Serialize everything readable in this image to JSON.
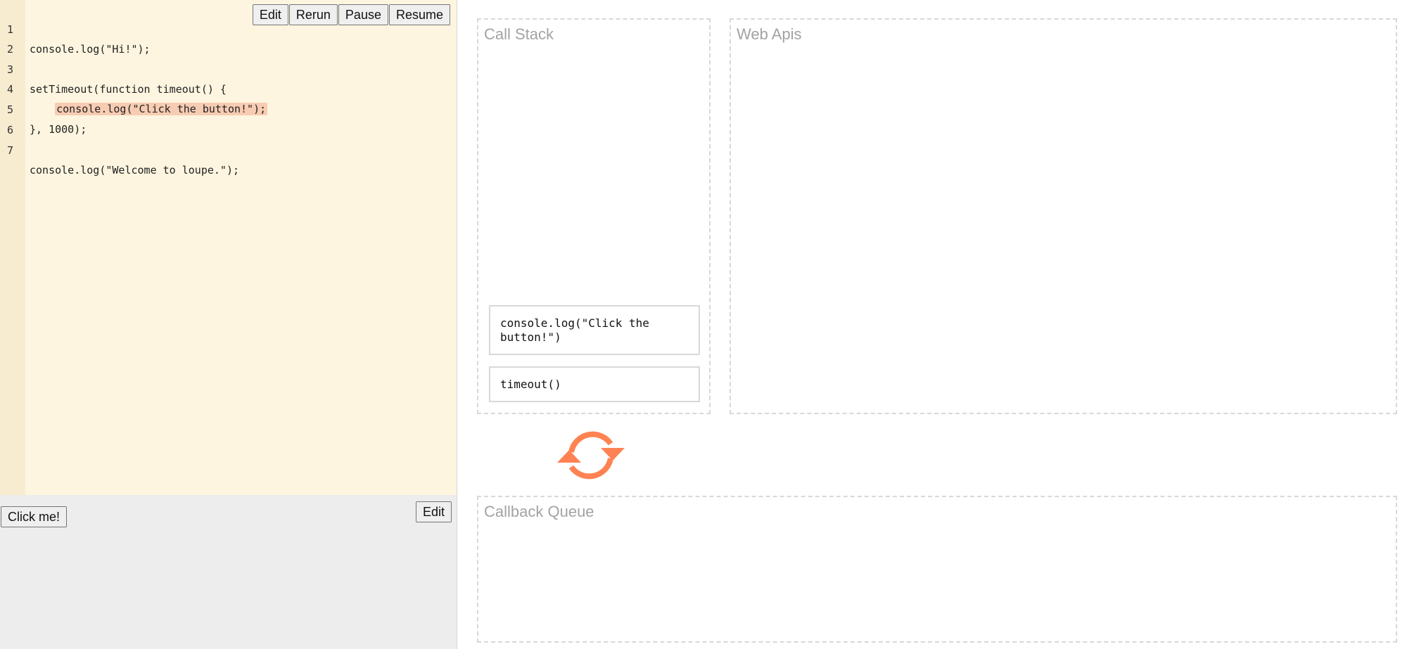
{
  "editor": {
    "lines": [
      {
        "num": "1",
        "code": "console.log(\"Hi!\");",
        "highlighted": false
      },
      {
        "num": "2",
        "code": "",
        "highlighted": false
      },
      {
        "num": "3",
        "code": "setTimeout(function timeout() {",
        "highlighted": false
      },
      {
        "num": "4",
        "code": "    console.log(\"Click the button!\");",
        "highlighted": true
      },
      {
        "num": "5",
        "code": "}, 1000);",
        "highlighted": false
      },
      {
        "num": "6",
        "code": "",
        "highlighted": false
      },
      {
        "num": "7",
        "code": "console.log(\"Welcome to loupe.\");",
        "highlighted": false
      }
    ],
    "highlight_color": "#f7ccb2"
  },
  "toolbar": {
    "edit_label": "Edit",
    "rerun_label": "Rerun",
    "pause_label": "Pause",
    "resume_label": "Resume"
  },
  "html_pane": {
    "click_button_label": "Click me!",
    "edit_label": "Edit"
  },
  "call_stack": {
    "title": "Call Stack",
    "frames": [
      "console.log(\"Click the button!\")",
      "timeout()"
    ]
  },
  "web_apis": {
    "title": "Web Apis"
  },
  "event_loop": {
    "icon": "refresh-icon",
    "color": "#ff8352"
  },
  "callback_queue": {
    "title": "Callback Queue"
  }
}
